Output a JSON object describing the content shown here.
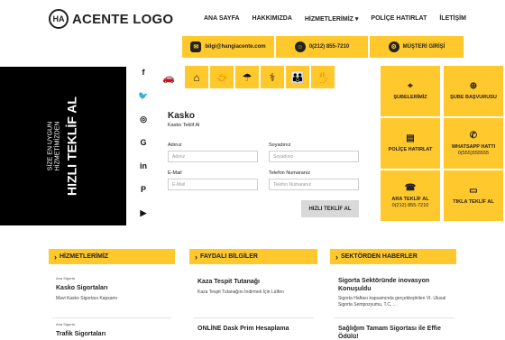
{
  "logo": {
    "mark": "HA",
    "text": "ACENTE LOGO"
  },
  "nav": {
    "items": [
      "ANA SAYFA",
      "HAKKIMIZDA",
      "HİZMETLERİMİZ",
      "POLİÇE HATIRLAT",
      "İLETİŞİM"
    ]
  },
  "contact": {
    "email": "bilgi@hangiacente.com",
    "phone": "0(212) 855-7210",
    "login": "MÜŞTERİ GİRİŞİ"
  },
  "banner": {
    "line1": "SİZE EN UYGUN",
    "line2": "HİZMETİMİZDEN",
    "main": "HIZLI TEKLİF AL"
  },
  "form": {
    "title": "Kasko",
    "subtitle": "Kasko Teklif Al",
    "name_label": "Adınız",
    "name_placeholder": "Adınız",
    "surname_label": "Soyadınız",
    "surname_placeholder": "Soyadınız",
    "email_label": "E-Mail",
    "email_placeholder": "E-Mail",
    "phone_label": "Telefon Numaranız",
    "phone_placeholder": "Telefon Numaranız",
    "submit_label": "HIZLI TEKLİF AL"
  },
  "tiles": {
    "branches": "ŞUBELERİMİZ",
    "apply": "ŞUBE BAŞVURUSU",
    "policy": "POLİÇE HATIRLAT",
    "whatsapp": "WHATSAPP HATTI",
    "whatsapp_number": "0(555)555555",
    "call": "ARA TEKLİF AL",
    "call_number": "0(212) 855-7210",
    "click": "TIKLA TEKLİF AL"
  },
  "services": {
    "heading": "HİZMETLERİMİZ",
    "items": [
      {
        "tag": "Ana Sigorta",
        "title": "Kasko Sigortaları",
        "desc": "Mavi Kasko Sigortası Kapsamı"
      },
      {
        "tag": "Ana Sigorta",
        "title": "Trafik Sigortaları",
        "desc": ""
      }
    ]
  },
  "info": {
    "heading": "FAYDALI BİLGİLER",
    "items": [
      {
        "title": "Kaza Tespit Tutanağı",
        "desc": "Kaza Tespit Tutanağını İndirmek İçin Lütfen"
      },
      {
        "title": "ONLİNE Dask Prim Hesaplama",
        "desc": ""
      }
    ]
  },
  "news": {
    "heading": "SEKTÖRDEN HABERLER",
    "items": [
      {
        "title": "Sigorta Sektöründe inovasyon Konuşuldu",
        "desc": "Sigorta Haftası kapsamında gerçekleştirilen VI. Ulusal Sigorta Sempozyumu, T.C. ..."
      },
      {
        "title": "Sağlığım Tamam Sigortası ile Effie Ödülü!",
        "desc": ""
      }
    ]
  },
  "colors": {
    "accent": "#ffc82c",
    "dark": "#000000"
  }
}
